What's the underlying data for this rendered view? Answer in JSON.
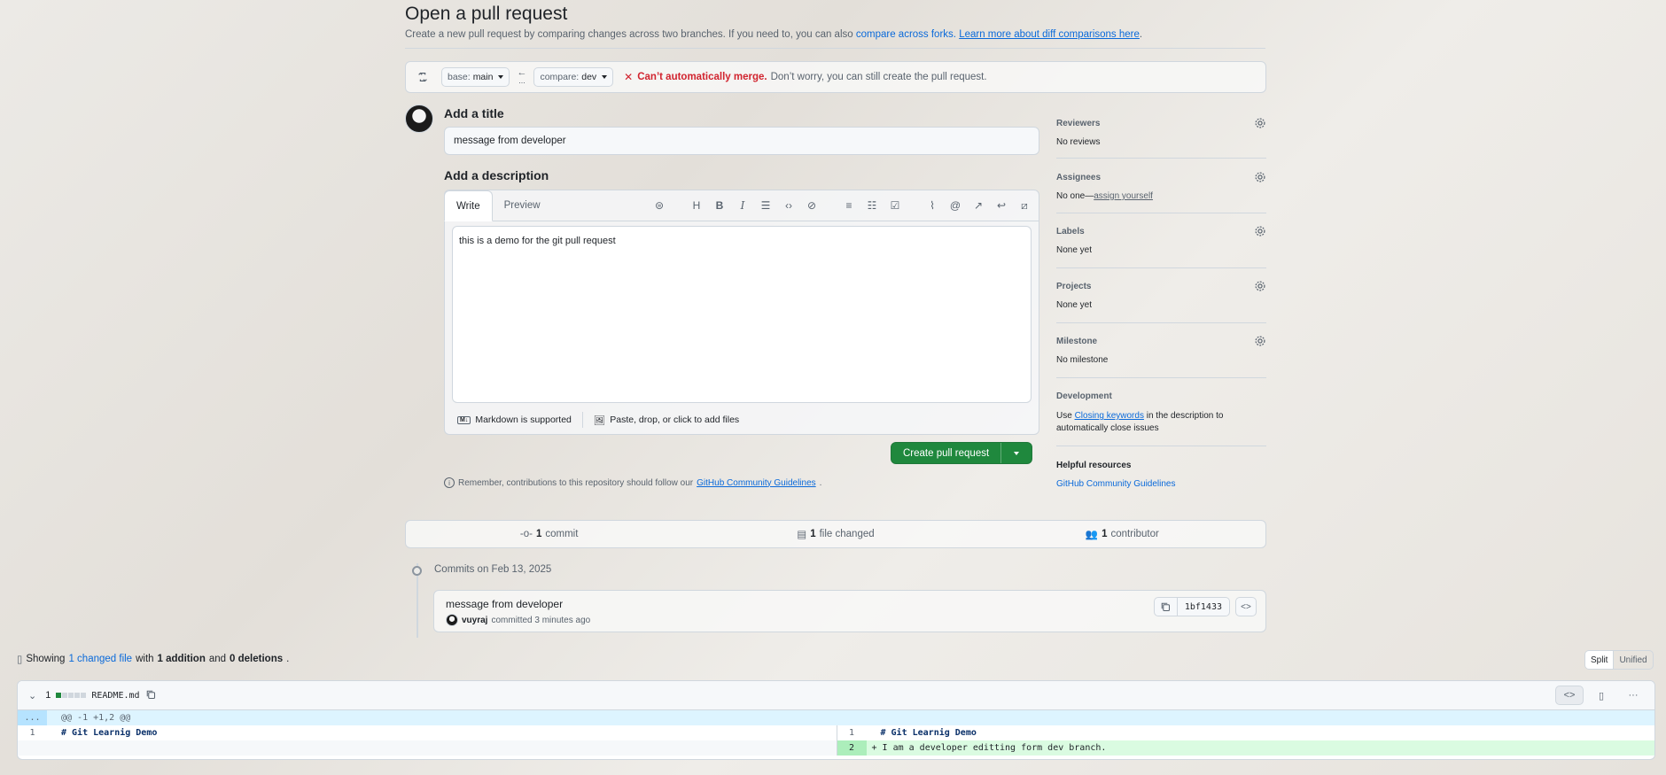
{
  "header": {
    "title": "Open a pull request",
    "subtitle_pre": "Create a new pull request by comparing changes across two branches. If you need to, you can also",
    "compare_forks_link": "compare across forks.",
    "learn_more_link": "Learn more about diff comparisons here",
    "subtitle_end": "."
  },
  "branch_bar": {
    "base_label": "base:",
    "base_value": "main",
    "compare_label": "compare:",
    "compare_value": "dev",
    "error_title": "Can’t automatically merge.",
    "error_note": "Don’t worry, you can still create the pull request."
  },
  "form": {
    "title_heading": "Add a title",
    "title_value": "message from developer",
    "desc_heading": "Add a description",
    "tab_write": "Write",
    "tab_preview": "Preview",
    "desc_value": "this is a demo for the git pull request",
    "markdown_note": "Markdown is supported",
    "files_note": "Paste, drop, or click to add files",
    "create_button": "Create pull request",
    "remember_text": "Remember, contributions to this repository should follow our",
    "guidelines_link": "GitHub Community Guidelines",
    "remember_end": "."
  },
  "sidebar": {
    "reviewers": {
      "label": "Reviewers",
      "value": "No reviews"
    },
    "assignees": {
      "label": "Assignees",
      "value": "No one—",
      "link": "assign yourself"
    },
    "labels": {
      "label": "Labels",
      "value": "None yet"
    },
    "projects": {
      "label": "Projects",
      "value": "None yet"
    },
    "milestone": {
      "label": "Milestone",
      "value": "No milestone"
    },
    "development": {
      "label": "Development",
      "pre": "Use",
      "link": "Closing keywords",
      "post": "in the description to automatically close issues"
    },
    "helpful": {
      "label": "Helpful resources",
      "link": "GitHub Community Guidelines"
    }
  },
  "summary": {
    "commits_count": "1",
    "commits_label": "commit",
    "files_count": "1",
    "files_label": "file changed",
    "contributors_count": "1",
    "contributors_label": "contributor"
  },
  "commits": {
    "date_label": "Commits on Feb 13, 2025",
    "items": [
      {
        "title": "message from developer",
        "author": "vuyraj",
        "meta": "committed 3 minutes ago",
        "sha": "1bf1433"
      }
    ]
  },
  "diff_summary": {
    "pre": "Showing",
    "changed_link": "1 changed file",
    "with": "with",
    "additions": "1 addition",
    "and": "and",
    "deletions": "0 deletions",
    "end": ".",
    "view_split": "Split",
    "view_unified": "Unified"
  },
  "file": {
    "changes": "1",
    "name": "README.md",
    "hunk_expand": "...",
    "hunk": "@@ -1 +1,2 @@",
    "left": [
      {
        "num": "1",
        "text": "# Git Learnig Demo"
      }
    ],
    "right": [
      {
        "num": "1",
        "text": "# Git Learnig Demo"
      },
      {
        "num": "2",
        "text": "+ I am a developer editting form dev branch."
      }
    ]
  },
  "colors": {
    "accent": "#0969da",
    "success": "#1f883d",
    "danger": "#d1242f"
  }
}
